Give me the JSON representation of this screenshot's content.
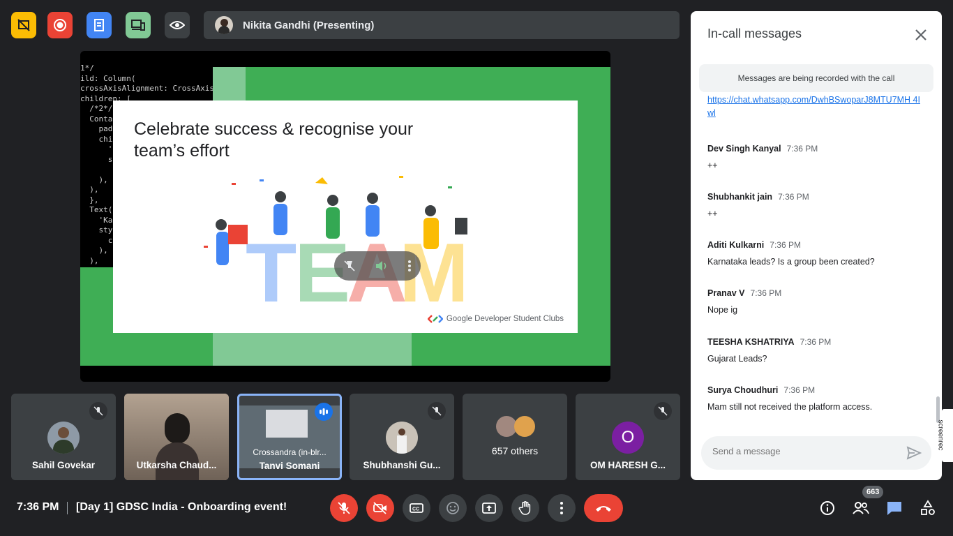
{
  "presenter": {
    "name": "Nikita Gandhi (Presenting)"
  },
  "toolbar_top": [
    {
      "icon": "no-slides-icon",
      "color": "#fbbc04"
    },
    {
      "icon": "record-icon",
      "color": "#ea4335"
    },
    {
      "icon": "notes-icon",
      "color": "#4285f4"
    },
    {
      "icon": "devices-icon",
      "color": "#81c995"
    },
    {
      "icon": "eye-icon",
      "color": "#3c4043"
    }
  ],
  "presentation": {
    "code_lines": [
      "1*/",
      "ild: Column(",
      "crossAxisAlignment: CrossAxis",
      "children: [",
      "  /*2*/",
      "  Conta",
      "    pad",
      "    chi",
      "      '",
      "      s",
      "",
      "    ),",
      "  ),",
      "  },",
      "  Text(",
      "    'Ka",
      "    sty",
      "      c",
      "    ),",
      "  ),",
      "}"
    ],
    "slide_title": "Celebrate success & recognise your team’s effort",
    "illustration_word": "TEAM",
    "footer_brand": "Google Developer Student Clubs"
  },
  "participants": [
    {
      "name": "Sahil Govekar",
      "muted": true
    },
    {
      "name": "Utkarsha Chaud...",
      "muted": false
    },
    {
      "name": "Crossandra (in-blr...",
      "subname": "Tanvi Somani",
      "muted": false,
      "speaking": true
    },
    {
      "name": "Shubhanshi Gu...",
      "muted": true
    },
    {
      "name": "657 others",
      "muted": false
    },
    {
      "name": "OM HARESH G...",
      "initial": "O",
      "muted": true
    }
  ],
  "chat": {
    "title": "In-call messages",
    "banner": "Messages are being recorded with the call",
    "link_partial": "https://chat.whatsapp.com/DwhBSwoparJ8MTU7MH 4Iwl",
    "messages": [
      {
        "name": "Dev Singh Kanyal",
        "time": "7:36 PM",
        "text": "++"
      },
      {
        "name": "Shubhankit jain",
        "time": "7:36 PM",
        "text": "++"
      },
      {
        "name": "Aditi Kulkarni",
        "time": "7:36 PM",
        "text": "Karnataka leads? Is a group been created?"
      },
      {
        "name": "Pranav V",
        "time": "7:36 PM",
        "text": "Nope ig"
      },
      {
        "name": "TEESHA KSHATRIYA",
        "time": "7:36 PM",
        "text": "Gujarat Leads?"
      },
      {
        "name": "Surya Choudhuri",
        "time": "7:36 PM",
        "text": "Mam still not received the platform access."
      }
    ],
    "input_placeholder": "Send a message"
  },
  "bottom": {
    "time": "7:36 PM",
    "separator": "|",
    "meeting_title": "[Day 1] GDSC India - Onboarding event!",
    "participant_count": "663"
  },
  "screenrec_label": "screenrec",
  "colors": {
    "accent_red": "#ea4335",
    "chat_blue": "#1a73e8",
    "surface": "#3c4043",
    "bg": "#202124"
  }
}
